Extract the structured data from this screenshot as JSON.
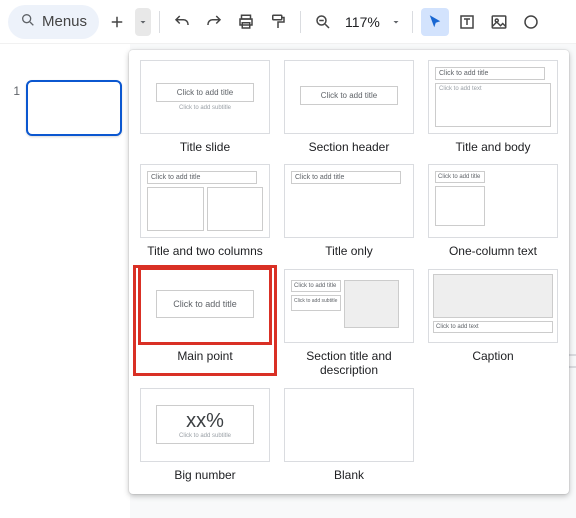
{
  "toolbar": {
    "search_label": "Menus",
    "zoom_level": "117%"
  },
  "sidebar": {
    "slide_number": "1"
  },
  "layouts": {
    "ph_title": "Click to add title",
    "ph_subtitle": "Click to add subtitle",
    "ph_text": "Click to add text",
    "big_number": "xx%",
    "items": [
      {
        "label": "Title slide"
      },
      {
        "label": "Section header"
      },
      {
        "label": "Title and body"
      },
      {
        "label": "Title and two columns"
      },
      {
        "label": "Title only"
      },
      {
        "label": "One-column text"
      },
      {
        "label": "Main point"
      },
      {
        "label": "Section title and description"
      },
      {
        "label": "Caption"
      },
      {
        "label": "Big number"
      },
      {
        "label": "Blank"
      }
    ]
  }
}
